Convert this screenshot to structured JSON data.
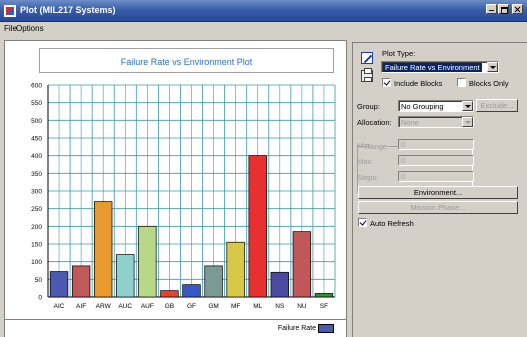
{
  "window": {
    "title": "Plot (MIL217 Systems)"
  },
  "menu": {
    "items": [
      "File",
      "Options"
    ]
  },
  "chart": {
    "title": "Failure Rate vs Environment Plot",
    "legend_label": "Failure Rate",
    "y_ticks": [
      "600",
      "550",
      "500",
      "450",
      "400",
      "350",
      "300",
      "250",
      "200",
      "150",
      "100",
      "50",
      "0"
    ]
  },
  "chart_data": {
    "type": "bar",
    "title": "Failure Rate vs Environment Plot",
    "xlabel": "",
    "ylabel": "",
    "ylim": [
      0,
      600
    ],
    "grid": true,
    "legend_position": "bottom-right",
    "categories": [
      "AIC",
      "AIF",
      "ARW",
      "AUC",
      "AUF",
      "GB",
      "GF",
      "GM",
      "MF",
      "ML",
      "NS",
      "NU",
      "SF"
    ],
    "series": [
      {
        "name": "Failure Rate",
        "values": [
          72,
          88,
          270,
          120,
          200,
          18,
          35,
          88,
          155,
          400,
          70,
          185,
          10
        ],
        "colors": [
          "#4a5ab0",
          "#c05a5a",
          "#e89a2e",
          "#8ed0cc",
          "#b8d888",
          "#e8402a",
          "#3858c8",
          "#7a9a98",
          "#d8c848",
          "#e83030",
          "#4a4aa0",
          "#c05858",
          "#3a8a3a"
        ]
      }
    ]
  },
  "panel": {
    "plot_type_label": "Plot Type:",
    "plot_type_value": "Failure Rate vs Environment",
    "include_blocks_label": "Include Blocks",
    "blocks_only_label": "Blocks Only",
    "group_label": "Group:",
    "group_value": "No Grouping",
    "exclude_label": "Exclude...",
    "allocation_label": "Allocation:",
    "allocation_value": "None",
    "range_label": "Range",
    "min_label": "Min:",
    "min_value": "0",
    "max_label": "Max:",
    "max_value": "0",
    "steps_label": "Steps:",
    "steps_value": "0",
    "environment_button": "Environment...",
    "mission_phase_button": "Mission Phase...",
    "auto_refresh_label": "Auto Refresh"
  }
}
